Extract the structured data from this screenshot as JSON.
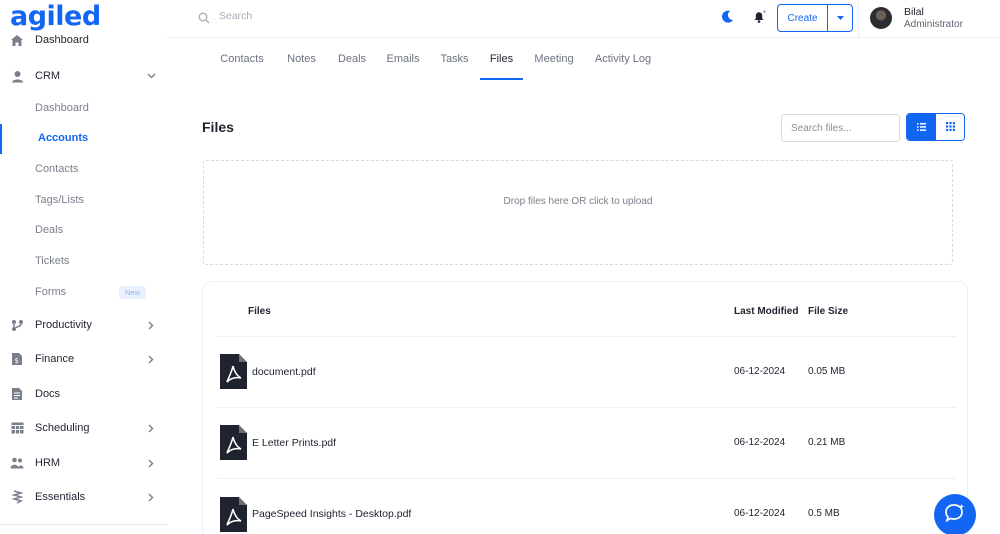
{
  "brand": {
    "logo": "agiled",
    "accent": "#1366f4"
  },
  "header": {
    "search_placeholder": "Search",
    "create_label": "Create",
    "user": {
      "name": "Bilal",
      "role": "Administrator"
    }
  },
  "sidebar": {
    "dashboard": "Dashboard",
    "crm": "CRM",
    "crm_items": [
      {
        "label": "Dashboard"
      },
      {
        "label": "Accounts",
        "active": true
      },
      {
        "label": "Contacts"
      },
      {
        "label": "Tags/Lists"
      },
      {
        "label": "Deals"
      },
      {
        "label": "Tickets"
      },
      {
        "label": "Forms",
        "badge": "New"
      }
    ],
    "sections": [
      {
        "label": "Productivity",
        "icon": "productivity-icon"
      },
      {
        "label": "Finance",
        "icon": "finance-icon"
      },
      {
        "label": "Docs",
        "icon": "docs-icon"
      },
      {
        "label": "Scheduling",
        "icon": "scheduling-icon"
      },
      {
        "label": "HRM",
        "icon": "hrm-icon"
      },
      {
        "label": "Essentials",
        "icon": "essentials-icon"
      }
    ]
  },
  "tabs": [
    {
      "label": "Contacts"
    },
    {
      "label": "Notes"
    },
    {
      "label": "Deals"
    },
    {
      "label": "Emails"
    },
    {
      "label": "Tasks"
    },
    {
      "label": "Files",
      "active": true
    },
    {
      "label": "Meeting"
    },
    {
      "label": "Activity Log"
    }
  ],
  "files": {
    "title": "Files",
    "search_placeholder": "Search files...",
    "dropzone_text": "Drop files here OR click to upload",
    "columns": {
      "name": "Files",
      "modified": "Last Modified",
      "size": "File Size"
    },
    "rows": [
      {
        "name": "document.pdf",
        "modified": "06-12-2024",
        "size": "0.05 MB"
      },
      {
        "name": "E Letter Prints.pdf",
        "modified": "06-12-2024",
        "size": "0.21 MB"
      },
      {
        "name": "PageSpeed Insights - Desktop.pdf",
        "modified": "06-12-2024",
        "size": "0.5 MB"
      }
    ]
  }
}
